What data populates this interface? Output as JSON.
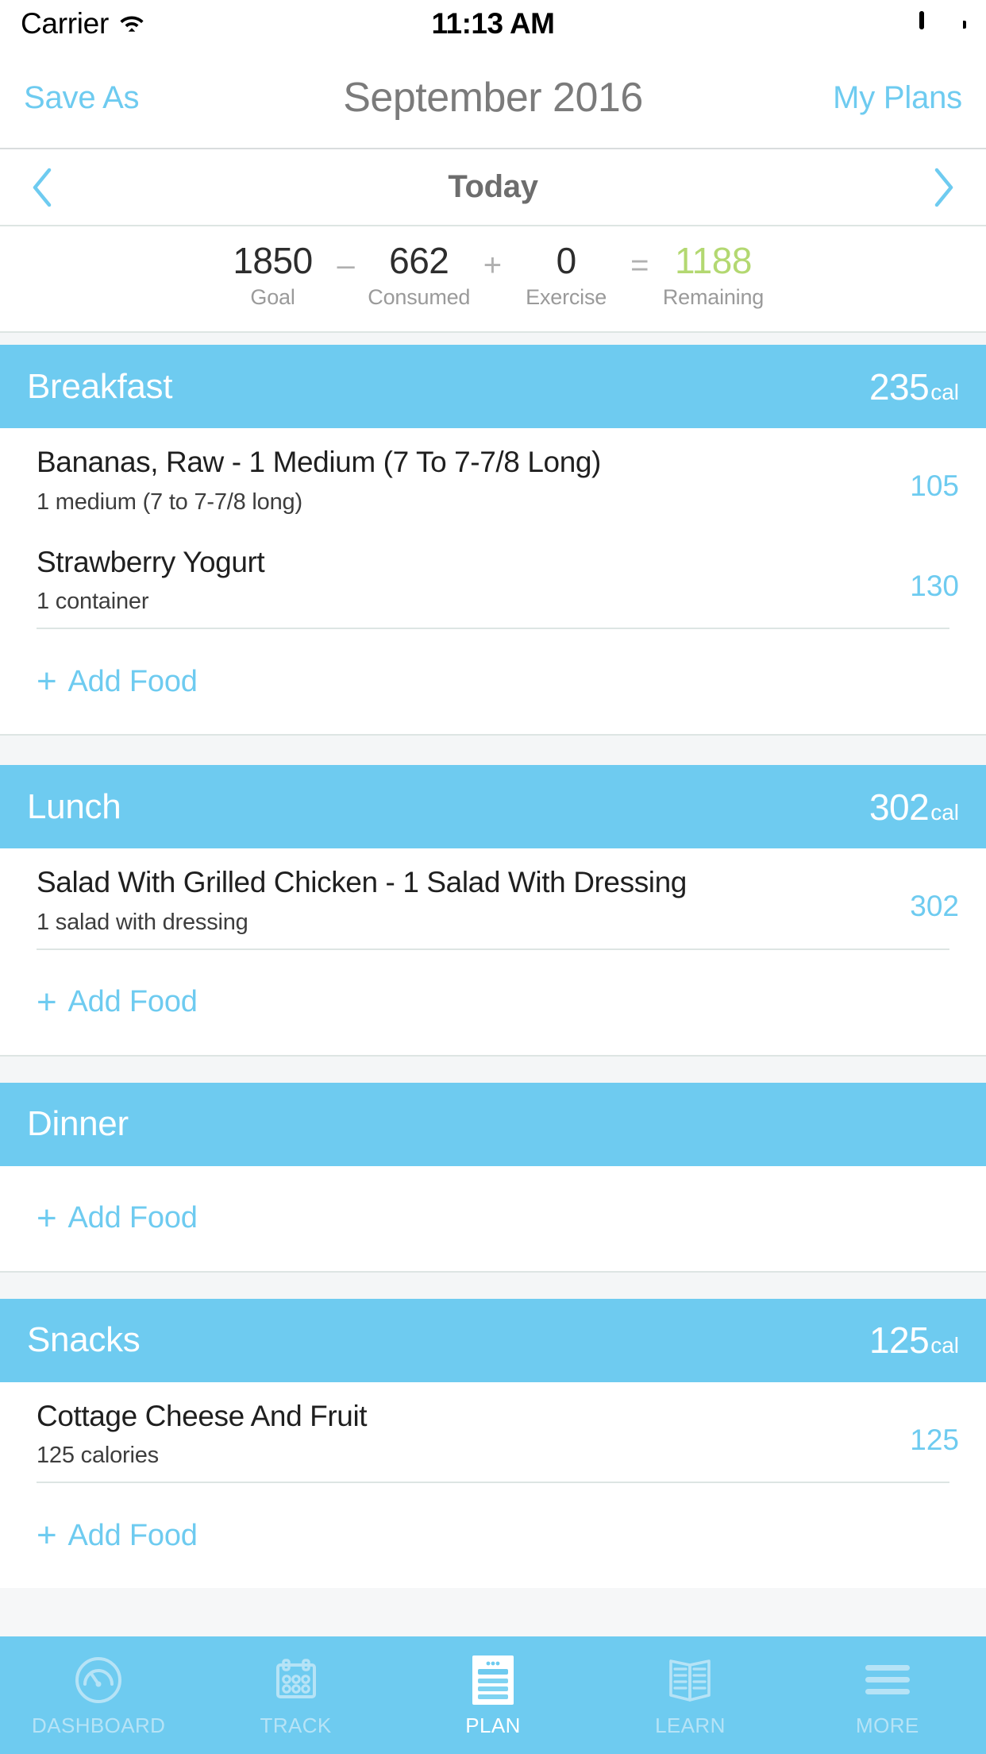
{
  "status_bar": {
    "carrier": "Carrier",
    "time": "11:13 AM",
    "wifi_icon": "wifi-icon",
    "battery_icon": "battery-full-icon"
  },
  "nav_bar": {
    "left_button": "Save As",
    "title": "September 2016",
    "right_button": "My Plans"
  },
  "day_selector": {
    "prev_icon": "chevron-left-icon",
    "title": "Today",
    "next_icon": "chevron-right-icon"
  },
  "summary": {
    "goal": {
      "value": "1850",
      "label": "Goal"
    },
    "op1": "–",
    "consumed": {
      "value": "662",
      "label": "Consumed"
    },
    "op2": "+",
    "exercise": {
      "value": "0",
      "label": "Exercise"
    },
    "op3": "=",
    "remaining": {
      "value": "1188",
      "label": "Remaining",
      "color": "#b3d871"
    }
  },
  "add_food_label": "Add Food",
  "calorie_unit": "cal",
  "meals": [
    {
      "name": "Breakfast",
      "calories": "235",
      "items": [
        {
          "name": "Bananas, Raw - 1 Medium (7 To 7-7/8 Long)",
          "serving": "1 medium (7 to 7-7/8 long)",
          "calories": "105"
        },
        {
          "name": "Strawberry Yogurt",
          "serving": "1 container",
          "calories": "130"
        }
      ]
    },
    {
      "name": "Lunch",
      "calories": "302",
      "items": [
        {
          "name": "Salad With Grilled Chicken - 1 Salad With Dressing",
          "serving": "1 salad with dressing",
          "calories": "302"
        }
      ]
    },
    {
      "name": "Dinner",
      "calories": "",
      "items": []
    },
    {
      "name": "Snacks",
      "calories": "125",
      "items": [
        {
          "name": "Cottage Cheese And Fruit",
          "serving": "125 calories",
          "calories": "125"
        }
      ]
    }
  ],
  "tab_bar": {
    "items": [
      {
        "label": "DASHBOARD",
        "icon": "speedometer-icon",
        "active": false
      },
      {
        "label": "TRACK",
        "icon": "calendar-icon",
        "active": false
      },
      {
        "label": "PLAN",
        "icon": "plan-document-icon",
        "active": true
      },
      {
        "label": "LEARN",
        "icon": "open-book-icon",
        "active": false
      },
      {
        "label": "MORE",
        "icon": "hamburger-menu-icon",
        "active": false
      }
    ]
  },
  "colors": {
    "accent": "#6ecbf0",
    "remaining_green": "#b3d871",
    "section_gap": "#f4f6f7"
  }
}
